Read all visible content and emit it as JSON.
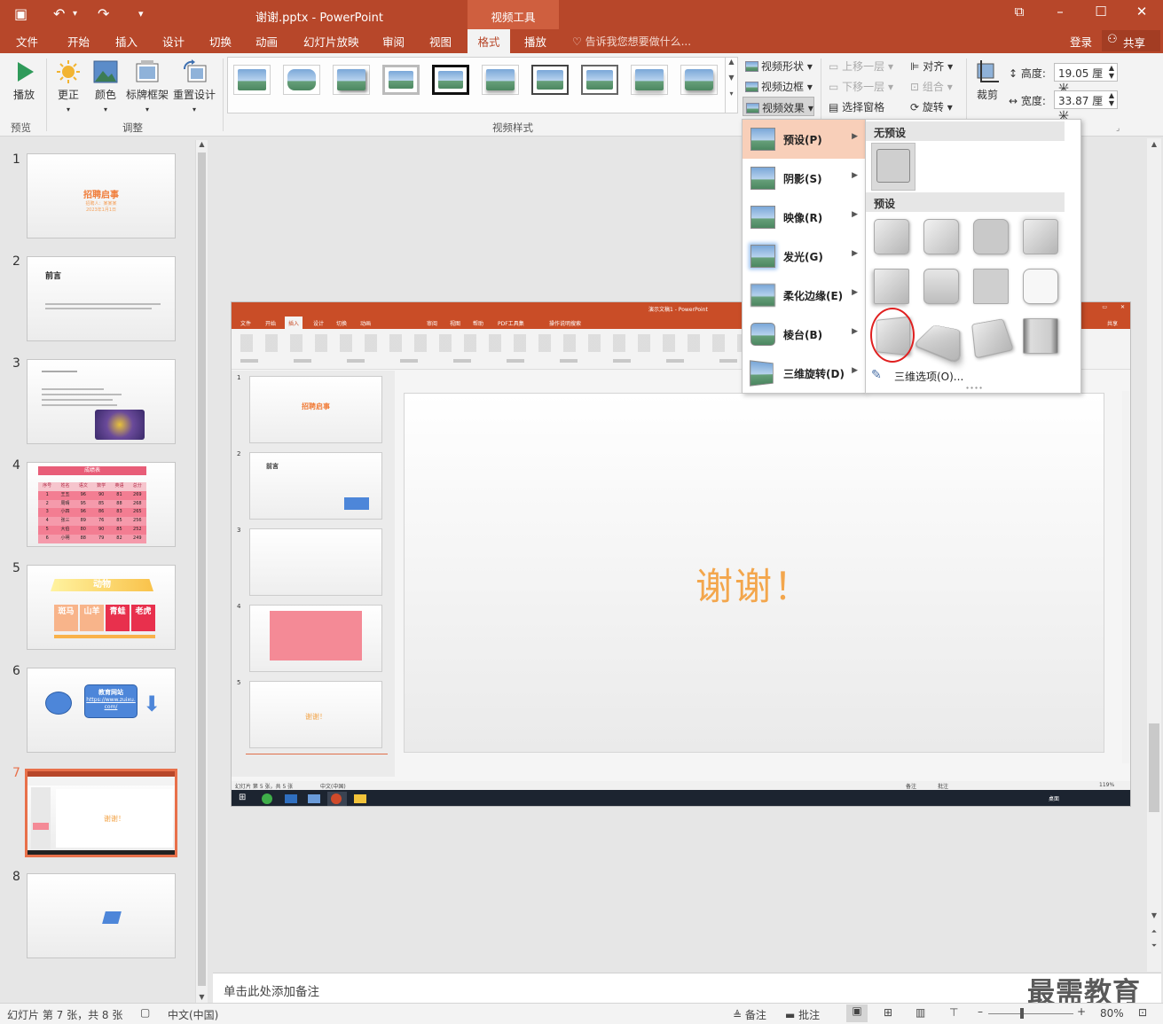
{
  "app": {
    "doc_title": "谢谢.pptx - PowerPoint",
    "context_tab": "视频工具",
    "account": "登录",
    "share": "共享",
    "tell_me": "告诉我您想要做什么..."
  },
  "tabs": [
    "文件",
    "开始",
    "插入",
    "设计",
    "切换",
    "动画",
    "幻灯片放映",
    "审阅",
    "视图",
    "格式",
    "播放"
  ],
  "active_tab": "格式",
  "ribbon": {
    "preview": {
      "play": "播放",
      "group": "预览"
    },
    "adjust": {
      "correct": "更正",
      "color": "颜色",
      "poster": "标牌框架",
      "reset": "重置设计",
      "group": "调整"
    },
    "styles_group": "视频样式",
    "video_shape": "视频形状",
    "video_border": "视频边框",
    "video_effects": "视频效果",
    "arrange": {
      "bring_forward": "上移一层",
      "send_backward": "下移一层",
      "selection_pane": "选择窗格",
      "align": "对齐",
      "group": "组合",
      "rotate": "旋转"
    },
    "size": {
      "crop": "裁剪",
      "height_label": "高度:",
      "height": "19.05 厘米",
      "width_label": "宽度:",
      "width": "33.87 厘米"
    }
  },
  "effects_menu": {
    "items": [
      "预设(P)",
      "阴影(S)",
      "映像(R)",
      "发光(G)",
      "柔化边缘(E)",
      "棱台(B)",
      "三维旋转(D)"
    ],
    "highlighted": "预设(P)"
  },
  "presets_panel": {
    "no_preset_header": "无预设",
    "preset_header": "预设",
    "three_d_options": "三维选项(O)...",
    "preset_count": 12,
    "circled_index": 8
  },
  "slides": {
    "numbers": [
      "1",
      "2",
      "3",
      "4",
      "5",
      "6",
      "7",
      "8"
    ],
    "selected": "7",
    "s1": {
      "title": "招聘启事",
      "line1": "招聘人：某某某",
      "line2": "2023年1月1日"
    },
    "s2": {
      "title": "前言"
    },
    "s4": {
      "title": "成绩表",
      "headers": [
        "序号",
        "姓名",
        "语文",
        "数学",
        "英语",
        "总分"
      ],
      "rows": [
        [
          "1",
          "王五",
          "96",
          "90",
          "81",
          "269"
        ],
        [
          "2",
          "周晴",
          "95",
          "85",
          "88",
          "268"
        ],
        [
          "3",
          "小四",
          "96",
          "86",
          "83",
          "265"
        ],
        [
          "4",
          "张三",
          "89",
          "76",
          "85",
          "256"
        ],
        [
          "5",
          "大伯",
          "80",
          "90",
          "85",
          "252"
        ],
        [
          "6",
          "小明",
          "88",
          "79",
          "82",
          "249"
        ]
      ]
    },
    "s5": {
      "title": "动物",
      "cells": [
        "斑马",
        "山羊",
        "青蛙",
        "老虎"
      ]
    },
    "s6": {
      "box_title": "教育网站",
      "link": "https://www.zuixu.com/"
    },
    "s7": {
      "text": "谢谢！"
    }
  },
  "embedded": {
    "title": "演示文稿1 - PowerPoint",
    "tabs": [
      "文件",
      "开始",
      "插入",
      "设计",
      "切换",
      "动画",
      "审阅",
      "视图",
      "帮助",
      "PDF工具集",
      "操作说明搜索"
    ],
    "active_tab": "插入",
    "share": "共享",
    "slide_text": "谢谢！",
    "mini_slides": [
      "1",
      "2",
      "3",
      "4",
      "5"
    ],
    "mini_s1": "招聘启事",
    "mini_s2": "前言",
    "mini_s5": "谢谢！",
    "status": "幻灯片 第 5 张，共 5 张",
    "lang": "中文(中国)",
    "notes": "备注",
    "comments": "批注",
    "zoom": "119%",
    "taskbar_right": "桌面"
  },
  "notes_placeholder": "单击此处添加备注",
  "status": {
    "slide_info": "幻灯片 第 7 张，共 8 张",
    "lang": "中文(中国)",
    "notes": "备注",
    "comments": "批注",
    "zoom": "80%"
  },
  "watermark": "最需教育",
  "colors": {
    "accent": "#b7472a",
    "highlight": "#f8cfb9",
    "thanks_text": "#f3a64c",
    "selection": "#e8704a"
  }
}
